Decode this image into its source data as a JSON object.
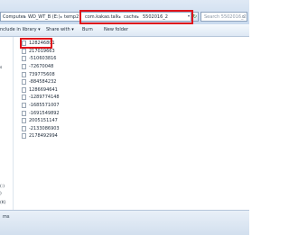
{
  "address_bar": {
    "crumbs": [
      "Computer",
      "WD_WT_B (E:)",
      "temp2",
      "com.kakao.talk",
      "cache",
      "5502016_2"
    ]
  },
  "search": {
    "placeholder": "Search 5502016_2"
  },
  "toolbar": {
    "include": "nclude in library",
    "share": "Share with",
    "burn": "Burn",
    "new_folder": "New folder"
  },
  "nav": [
    "s",
    "(:)",
    ")",
    "(K)"
  ],
  "files": [
    "128246801",
    "217019663",
    "-510603816",
    "-72670048",
    "739775608",
    "-884584232",
    "1286694641",
    "-1289774148",
    "-1685571007",
    "-1691549892",
    "2005151147",
    "-2133086903",
    "2178492994"
  ],
  "status": {
    "text": "ms"
  },
  "colors": {
    "highlight": "#e0141b",
    "toolbar": "#dde8f4"
  }
}
